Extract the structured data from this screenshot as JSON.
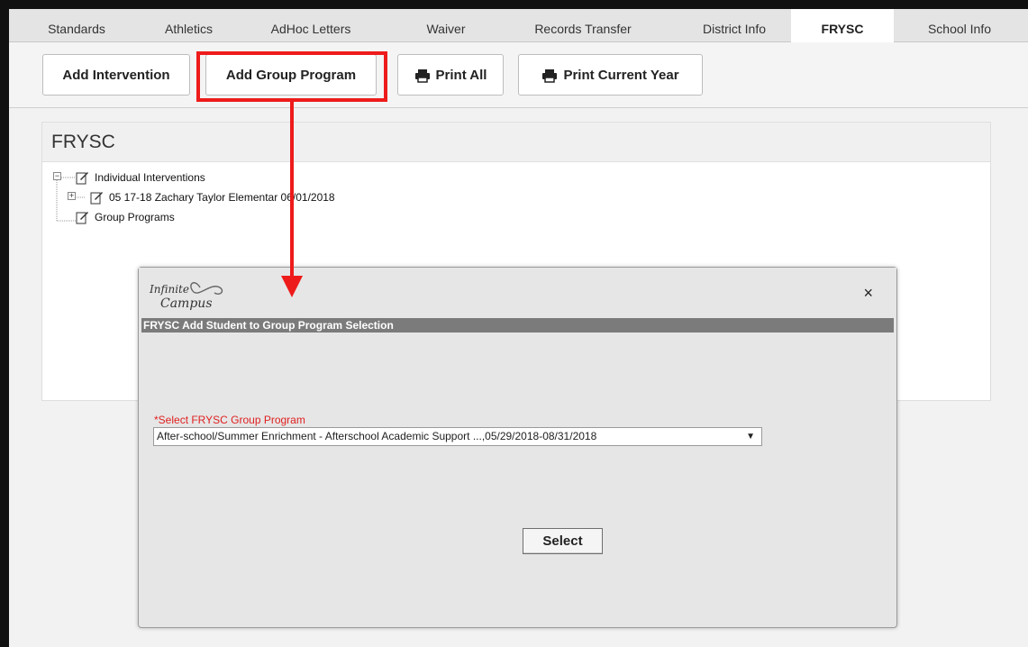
{
  "tabs": [
    {
      "label": "Standards",
      "active": false
    },
    {
      "label": "Athletics",
      "active": false
    },
    {
      "label": "AdHoc Letters",
      "active": false
    },
    {
      "label": "Waiver",
      "active": false
    },
    {
      "label": "Records Transfer",
      "active": false
    },
    {
      "label": "District Info",
      "active": false
    },
    {
      "label": "FRYSC",
      "active": true
    },
    {
      "label": "School Info",
      "active": false
    }
  ],
  "toolbar": {
    "add_intervention": "Add Intervention",
    "add_group_program": "Add Group Program",
    "print_all": "Print All",
    "print_current_year": "Print Current Year"
  },
  "panel": {
    "title": "FRYSC",
    "tree": {
      "individual": "Individual Interventions",
      "entry": "05 17-18 Zachary Taylor Elementar 06/01/2018",
      "group": "Group Programs"
    }
  },
  "modal": {
    "logo_top": "Infinite",
    "logo_bottom": "Campus",
    "close": "×",
    "title": "FRYSC Add Student to Group Program Selection",
    "field_label": "*Select FRYSC Group Program",
    "selected_option": "After-school/Summer Enrichment - Afterschool Academic Support ...,05/29/2018-08/31/2018",
    "select_button": "Select"
  },
  "colors": {
    "highlight": "#ee1b1b",
    "required_label": "#e02020",
    "modal_title_bar": "#7b7b7b"
  },
  "icons": {
    "printer": "printer-icon",
    "document": "note-document-icon",
    "close": "close-icon",
    "dropdown": "chevron-down-icon"
  }
}
